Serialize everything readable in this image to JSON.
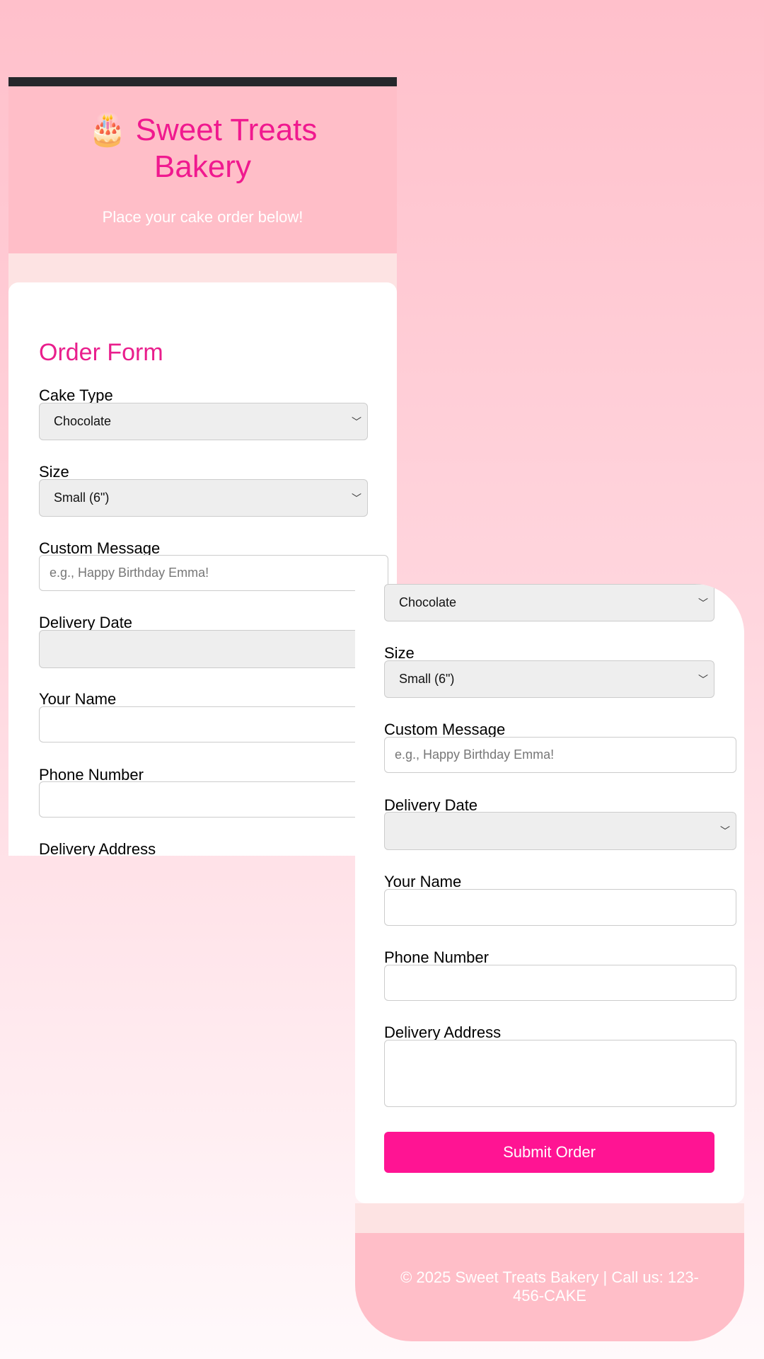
{
  "header": {
    "icon": "birthday-cake-emoji",
    "title": "🎂 Sweet Treats Bakery",
    "subtitle": "Place your cake order below!"
  },
  "form": {
    "heading": "Order Form",
    "cake_type": {
      "label": "Cake Type",
      "value": "Chocolate"
    },
    "size": {
      "label": "Size",
      "value": "Small (6\")"
    },
    "message": {
      "label": "Custom Message",
      "placeholder": "e.g., Happy Birthday Emma!"
    },
    "date": {
      "label": "Delivery Date",
      "value": ""
    },
    "name": {
      "label": "Your Name",
      "value": ""
    },
    "phone": {
      "label": "Phone Number",
      "value": ""
    },
    "address": {
      "label": "Delivery Address",
      "value": ""
    },
    "submit": "Submit Order"
  },
  "footer": {
    "text": "© 2025 Sweet Treats Bakery | Call us: 123-456-CAKE"
  },
  "colors": {
    "accent": "#ff1493",
    "title": "#f0198f",
    "header_bg": "#ffbec8",
    "topbar": "#25272b"
  }
}
